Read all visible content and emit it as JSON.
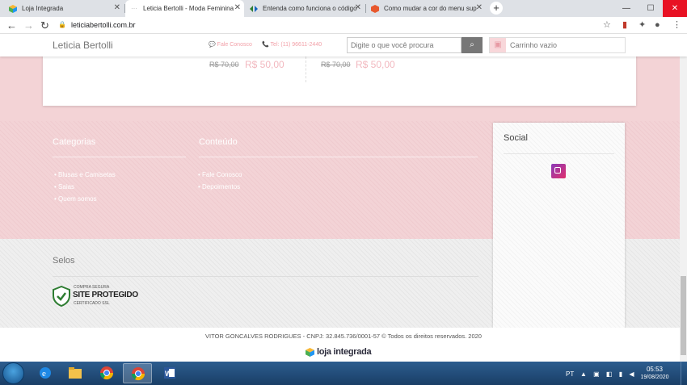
{
  "browser": {
    "tabs": [
      {
        "title": "Loja Integrada",
        "active": false,
        "icon": "loja-integrada-cube-icon"
      },
      {
        "title": "Leticia Bertolli - Moda Feminina",
        "active": true,
        "icon": "site-icon"
      },
      {
        "title": "Entenda como funciona o código",
        "active": false,
        "icon": "code-icon"
      },
      {
        "title": "Como mudar a cor do menu sup",
        "active": false,
        "icon": "cube-icon"
      }
    ],
    "new_tab": "+",
    "window_controls": {
      "minimize": "—",
      "maximize": "☐",
      "close": "✕"
    },
    "url": "leticiabertolli.com.br",
    "nav": {
      "back": "←",
      "forward": "→",
      "reload": "↻"
    },
    "extensions": {
      "star": "☆",
      "pdf": "▮",
      "puzzle": "✦",
      "profile": "●",
      "menu": "⋮"
    }
  },
  "site": {
    "header": {
      "title": "Leticia Bertolli",
      "contact": "Fale Conosco",
      "phone": "Tel: (11) 96611-2440",
      "search_placeholder": "Digite o que você procura",
      "search_button": "⌕",
      "cart_icon": "🛒",
      "cart_label": "Carrinho vazio"
    },
    "products": [
      {
        "old_price": "R$ 70,00",
        "new_price": "R$ 50,00"
      },
      {
        "old_price": "R$ 70,00",
        "new_price": "R$ 50,00"
      }
    ],
    "footer": {
      "categorias_title": "Categorias",
      "categorias": [
        "Blusas e Camisetas",
        "Saias",
        "Quem somos"
      ],
      "conteudo_title": "Conteúdo",
      "conteudo": [
        "Fale Conosco",
        "Depoimentos"
      ],
      "social_title": "Social",
      "selos_title": "Selos",
      "seal": {
        "line1": "COMPRA SEGURA",
        "line2": "SITE PROTEGIDO",
        "line3": "CERTIFICADO SSL"
      },
      "copyright": "VITOR GONCALVES RODRIGUES - CNPJ: 32.845.736/0001-57 © Todos os direitos reservados. 2020",
      "brand": "loja integrada"
    }
  },
  "taskbar": {
    "apps": [
      "internet-explorer-icon",
      "file-explorer-icon",
      "chrome-icon",
      "chrome-icon-active",
      "word-icon"
    ],
    "language": "PT",
    "tray_icons": "▲ ▣ ◧ ▮ ◀",
    "time": "05:53",
    "date": "19/08/2020"
  },
  "colors": {
    "accent_pink": "#f3d3d6",
    "price_pink": "#f2b8bf",
    "taskbar": "#1a3e66"
  }
}
